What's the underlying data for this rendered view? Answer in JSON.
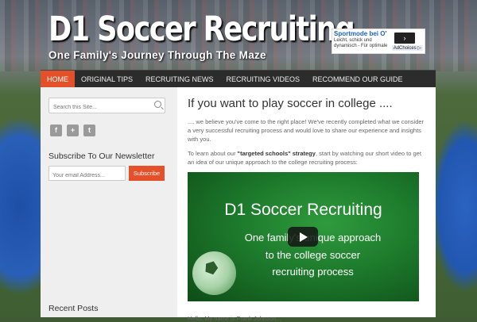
{
  "header": {
    "site_title": "D1 Soccer Recruiting",
    "tagline": "One Family's Journey Through The Maze"
  },
  "ad": {
    "title": "Sportmode bei O'",
    "line1": "Leicht, schick und",
    "line2": "dynamisch - Für optimale",
    "arrow": "›",
    "choices": "AdChoices ▷"
  },
  "nav": {
    "items": [
      "Home",
      "Original Tips",
      "Recruiting News",
      "Recruiting Videos",
      "Recommend Our Guide"
    ],
    "active_index": 0
  },
  "sidebar": {
    "search_placeholder": "Search this Site...",
    "social": [
      "f",
      "+",
      "t"
    ],
    "newsletter_title": "Subscribe To Our Newsletter",
    "email_placeholder": "Your email Address...",
    "subscribe_label": "Subscribe",
    "recent_posts_title": "Recent Posts"
  },
  "main": {
    "heading": "If you want to play soccer in college ....",
    "para1": ".... we believe you've come to the right place! We've recently completed what we consider a very successful recruiting process and would love to share our experience and insights with you.",
    "para2_pre": "To learn about our ",
    "para2_bold": "\"targeted schools\" strategy",
    "para2_post": ", start by watching our short video to get an idea of our unique approach to the college recruiting process:",
    "video": {
      "title": "D1 Soccer Recruiting",
      "line1": "One family's unique approach",
      "line2": "to the college soccer",
      "line3": "recruiting process"
    },
    "para3": "Hello, My name is Frank Johnson..."
  },
  "colors": {
    "accent": "#e4502a",
    "nav_bg": "#2c2c2c",
    "sidebar_bg": "#efefef"
  }
}
